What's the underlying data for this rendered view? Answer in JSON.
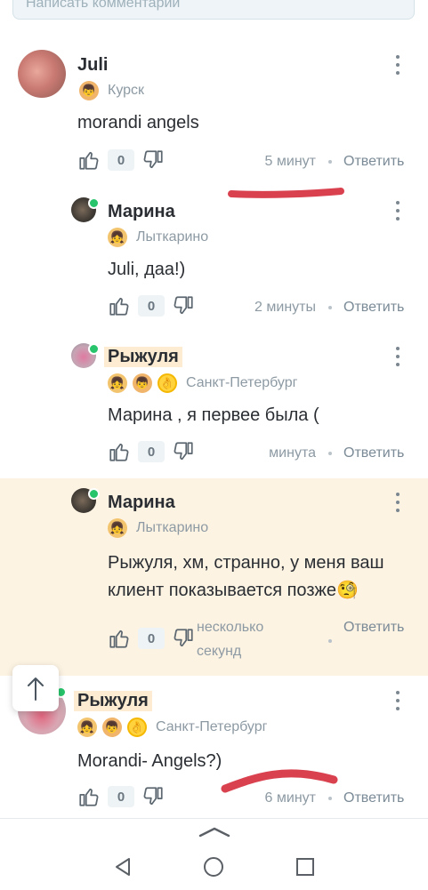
{
  "top_input": {
    "placeholder": "Написать комментарий"
  },
  "comments": [
    {
      "author": "Juli",
      "city": "Курск",
      "text": "morandi angels",
      "likes": "0",
      "time": "5 минут",
      "reply": "Ответить"
    },
    {
      "author": "Марина",
      "city": "Лыткарино",
      "text": "Juli, даа!)",
      "likes": "0",
      "time": "2 минуты",
      "reply": "Ответить"
    },
    {
      "author": "Рыжуля",
      "city": "Санкт-Петербург",
      "text": "Марина , я первее была (",
      "likes": "0",
      "time": "минута",
      "reply": "Ответить"
    },
    {
      "author": "Марина",
      "city": "Лыткарино",
      "text_line1": "Рыжуля, хм, странно, у меня ваш",
      "text_line2": "клиент показывается позже🧐",
      "likes": "0",
      "time_line1": "несколько",
      "time_line2": "секунд",
      "reply": "Ответить"
    },
    {
      "author": "Рыжуля",
      "city": "Санкт-Петербург",
      "text": "Morandi- Angels?)",
      "likes": "0",
      "time": "6 минут",
      "reply": "Ответить"
    }
  ],
  "icons": {
    "like": "thumbs-up-icon",
    "dislike": "thumbs-down-icon",
    "more": "more-vertical-icon",
    "scroll_top": "arrow-up-icon",
    "nav_back": "triangle-back-icon",
    "nav_home": "circle-home-icon",
    "nav_recents": "square-recents-icon"
  },
  "colors": {
    "annotation_red": "#d9414f",
    "highlight": "#fdf3e3",
    "online": "#27c46b"
  }
}
